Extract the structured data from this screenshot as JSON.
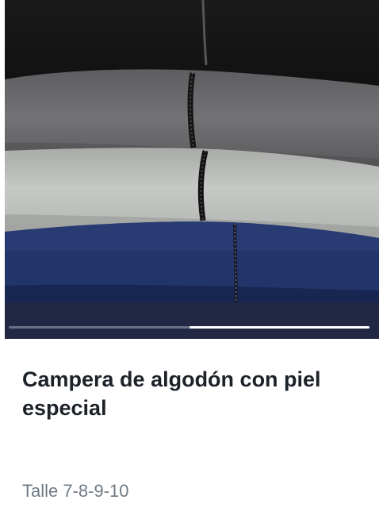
{
  "product": {
    "title": "Campera de algodón con piel especial",
    "subtitle": "Talle 7-8-9-10"
  },
  "gallery": {
    "image": "stacked-cotton-jackets-photo",
    "progress": 0.5,
    "active_segment": 2,
    "segment_count": 2
  },
  "colors": {
    "gallery_bar": "#222844",
    "title": "#1d2229",
    "subtitle": "#707a84",
    "jacket_black": "#1c1c1d",
    "jacket_dark_gray": "#6a696b",
    "jacket_light_gray": "#bfc1bf",
    "jacket_navy": "#24386e"
  }
}
